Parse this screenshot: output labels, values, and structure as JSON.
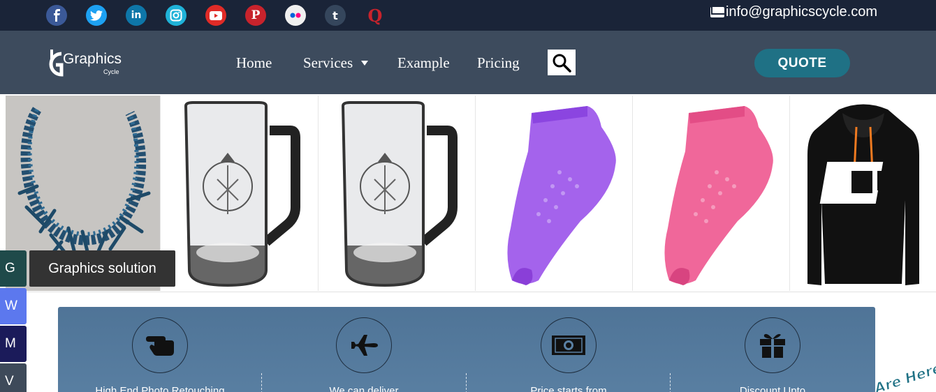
{
  "topbar": {
    "social": [
      {
        "name": "facebook",
        "glyph": "f",
        "color": "#3b5998"
      },
      {
        "name": "twitter",
        "glyph": "t",
        "color": "#1da1f2"
      },
      {
        "name": "linkedin",
        "glyph": "in",
        "color": "#0e76a8"
      },
      {
        "name": "instagram",
        "glyph": "◎",
        "color": "#1fb2d8"
      },
      {
        "name": "youtube",
        "glyph": "▶",
        "color": "#e02b27"
      },
      {
        "name": "pinterest",
        "glyph": "P",
        "color": "#c8232c"
      },
      {
        "name": "flickr",
        "glyph": "●●",
        "color": "#f0f0f0"
      },
      {
        "name": "tumblr",
        "glyph": "t",
        "color": "#35465c"
      },
      {
        "name": "quora",
        "glyph": "Q",
        "color": "#b92b27"
      }
    ],
    "email": "info@graphicscycle.com"
  },
  "nav": {
    "logo_text": "Graphics",
    "logo_sub": "Cycle",
    "links": [
      "Home",
      "Services",
      "Example",
      "Pricing"
    ],
    "quote_label": "QUOTE"
  },
  "products": {
    "caption": "Graphics solution",
    "items": [
      "necklace",
      "glass-mug",
      "glass-mug",
      "purple-sock",
      "pink-sock",
      "black-hoodie"
    ]
  },
  "side_tabs": [
    {
      "label": "G",
      "color": "#1f4a4a"
    },
    {
      "label": "W",
      "color": "#5c78ee"
    },
    {
      "label": "M",
      "color": "#1b1b5a"
    },
    {
      "label": "V",
      "color": "#3e4a5a"
    }
  ],
  "features": [
    {
      "icon": "hand-icon",
      "text": "High End Photo Retouching"
    },
    {
      "icon": "airplane-icon",
      "text": "We can deliver"
    },
    {
      "icon": "money-icon",
      "text": "Price starts from"
    },
    {
      "icon": "gift-icon",
      "text": "Discount Upto"
    }
  ],
  "badge": "Are Here"
}
